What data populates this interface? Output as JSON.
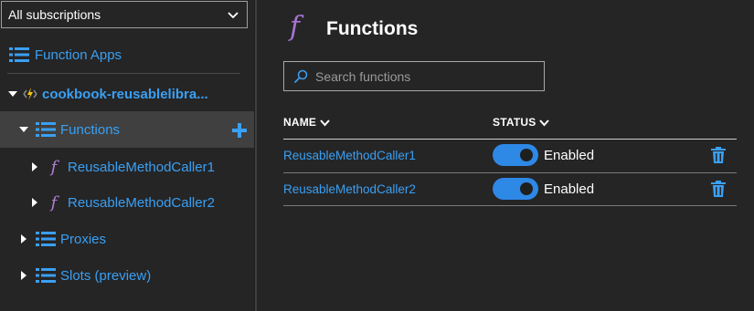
{
  "sidebar": {
    "subscription": "All subscriptions",
    "function_apps": "Function Apps",
    "app_name": "cookbook-reusablelibra...",
    "functions": "Functions",
    "items": [
      {
        "label": "ReusableMethodCaller1"
      },
      {
        "label": "ReusableMethodCaller2"
      }
    ],
    "proxies": "Proxies",
    "slots": "Slots (preview)"
  },
  "main": {
    "title": "Functions",
    "search_placeholder": "Search functions",
    "columns": {
      "name": "NAME",
      "status": "STATUS"
    },
    "rows": [
      {
        "name": "ReusableMethodCaller1",
        "status": "Enabled"
      },
      {
        "name": "ReusableMethodCaller2",
        "status": "Enabled"
      }
    ]
  },
  "colors": {
    "accent": "#3aa0f3",
    "toggle": "#2e88e6",
    "function_icon": "#a874d1"
  },
  "icons": [
    "chevron-down-icon",
    "list-icon",
    "lightning-icon",
    "function-icon",
    "plus-icon",
    "search-icon",
    "trash-icon",
    "caret-right-icon",
    "caret-down-icon"
  ]
}
